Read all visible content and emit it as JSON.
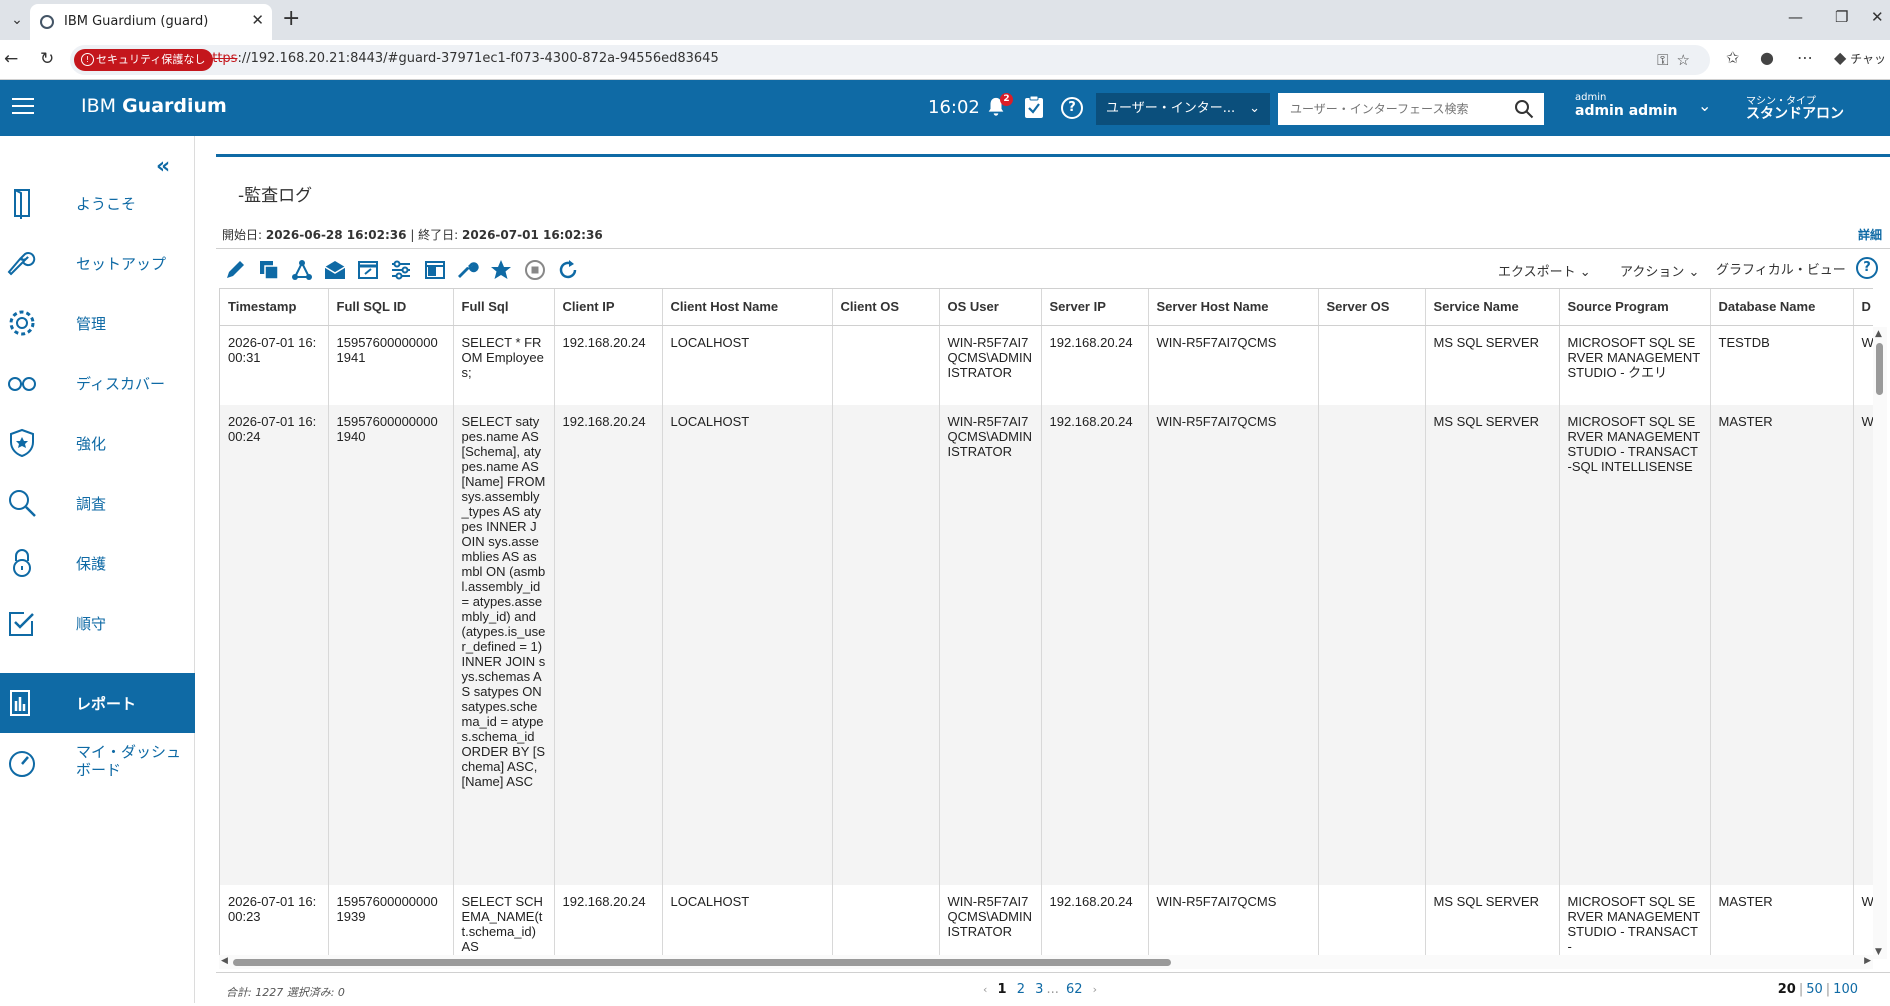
{
  "browser": {
    "tab_title": "IBM Guardium (guard)",
    "security_badge": "セキュリティ保護なし",
    "url_scheme": "https",
    "url_rest": "://192.168.20.21:8443/#guard-37971ec1-f073-4300-872a-94556ed83645",
    "copilot_label": "チャッ"
  },
  "header": {
    "brand_prefix": "IBM ",
    "brand_name": "Guardium",
    "time": "16:02",
    "notification_count": "2",
    "help_label": "?",
    "ui_dropdown": "ユーザー・インター...",
    "search_placeholder": "ユーザー・インターフェース検索",
    "user_small": "admin",
    "user_name": "admin admin",
    "machine_small": "マシン・タイプ",
    "machine_name": "スタンドアロン"
  },
  "sidebar": {
    "items": [
      {
        "label": "ようこそ"
      },
      {
        "label": "セットアップ"
      },
      {
        "label": "管理"
      },
      {
        "label": "ディスカバー"
      },
      {
        "label": "強化"
      },
      {
        "label": "調査"
      },
      {
        "label": "保護"
      },
      {
        "label": "順守"
      },
      {
        "label": "レポート"
      },
      {
        "label": "マイ・ダッシュ",
        "label2": "ボード"
      }
    ]
  },
  "report": {
    "title": "-監査ログ",
    "start_label": "開始日: ",
    "start_date": "2026-06-28 16:02:36",
    "sep": " | ",
    "end_label": "終了日: ",
    "end_date": "2026-07-01 16:02:36",
    "detail": "詳細",
    "export": "エクスポート",
    "action": "アクション",
    "graphical": "グラフィカル・ビュー",
    "help_label": "?",
    "columns": [
      "Timestamp",
      "Full SQL ID",
      "Full Sql",
      "Client IP",
      "Client Host Name",
      "Client OS",
      "OS User",
      "Server IP",
      "Server Host Name",
      "Server OS",
      "Service Name",
      "Source Program",
      "Database Name",
      "D"
    ],
    "rows": [
      {
        "timestamp": "2026-07-01 16:00:31",
        "full_sql_id": "159576000000001941",
        "full_sql": "SELECT * FROM Employees;",
        "client_ip": "192.168.20.24",
        "client_host": "LOCALHOST",
        "client_os": "",
        "os_user": "WIN-R5F7AI7QCMS\\ADMINISTRATOR",
        "server_ip": "192.168.20.24",
        "server_host": "WIN-R5F7AI7QCMS",
        "server_os": "",
        "service_name": "MS SQL SERVER",
        "source_program": "MICROSOFT SQL SERVER MANAGEMENT STUDIO - クエリ",
        "database_name": "TESTDB",
        "d": "W R M"
      },
      {
        "timestamp": "2026-07-01 16:00:24",
        "full_sql_id": "159576000000001940",
        "full_sql": "SELECT satypes.name AS [Schema], atypes.name AS [Name] FROM sys.assembly_types AS atypes INNER JOIN sys.assemblies AS asmbl ON (asmbl.assembly_id = atypes.assembly_id) and (atypes.is_user_defined = 1) INNER JOIN sys.schemas AS satypes ON satypes.schema_id = atypes.schema_id ORDER BY [Schema] ASC,[Name] ASC",
        "client_ip": "192.168.20.24",
        "client_host": "LOCALHOST",
        "client_os": "",
        "os_user": "WIN-R5F7AI7QCMS\\ADMINISTRATOR",
        "server_ip": "192.168.20.24",
        "server_host": "WIN-R5F7AI7QCMS",
        "server_os": "",
        "service_name": "MS SQL SERVER",
        "source_program": "MICROSOFT SQL SERVER MANAGEMENT STUDIO - TRANSACT-SQL INTELLISENSE",
        "database_name": "MASTER",
        "d": "W R M"
      },
      {
        "timestamp": "2026-07-01 16:00:23",
        "full_sql_id": "159576000000001939",
        "full_sql": "SELECT SCHEMA_NAME(tt.schema_id) AS",
        "client_ip": "192.168.20.24",
        "client_host": "LOCALHOST",
        "client_os": "",
        "os_user": "WIN-R5F7AI7QCMS\\ADMINISTRATOR",
        "server_ip": "192.168.20.24",
        "server_host": "WIN-R5F7AI7QCMS",
        "server_os": "",
        "service_name": "MS SQL SERVER",
        "source_program": "MICROSOFT SQL SERVER MANAGEMENT STUDIO - TRANSACT-",
        "database_name": "MASTER",
        "d": "W R M"
      }
    ],
    "footer": {
      "total": "合計: 1227 選択済み: 0",
      "pages": [
        "1",
        "2",
        "3",
        "...",
        "62"
      ],
      "current_page": "1",
      "page_sizes": [
        "20",
        "50",
        "100"
      ],
      "current_size": "20"
    }
  },
  "colors": {
    "accent": "#0f6aa5",
    "danger": "#c4161c"
  }
}
